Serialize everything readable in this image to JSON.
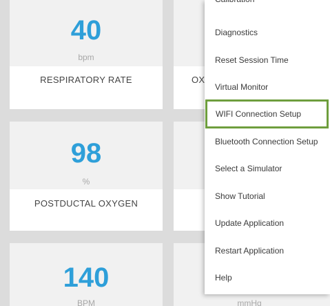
{
  "tiles": [
    {
      "value": "40",
      "unit": "bpm",
      "label": "RESPIRATORY RATE"
    },
    {
      "value": "",
      "unit": "",
      "label": "OX"
    },
    {
      "value": "98",
      "unit": "%",
      "label": "POSTDUCTAL OXYGEN"
    },
    {
      "value": "",
      "unit": "",
      "label": ""
    },
    {
      "value": "140",
      "unit": "BPM",
      "label": ""
    },
    {
      "value": "",
      "unit": "mmHg",
      "label": ""
    }
  ],
  "menu": {
    "items": [
      {
        "label": "Calibration"
      },
      {
        "label": "Diagnostics"
      },
      {
        "label": "Reset Session Time"
      },
      {
        "label": "Virtual Monitor"
      },
      {
        "label": "WIFI Connection Setup",
        "highlighted": true
      },
      {
        "label": "Bluetooth Connection Setup"
      },
      {
        "label": "Select a Simulator"
      },
      {
        "label": "Show Tutorial"
      },
      {
        "label": "Update Application"
      },
      {
        "label": "Restart Application"
      },
      {
        "label": "Help"
      }
    ],
    "highlight_color": "#6e9e3d"
  },
  "colors": {
    "value_blue": "#2e9fd9",
    "background": "#dcdcdc"
  }
}
